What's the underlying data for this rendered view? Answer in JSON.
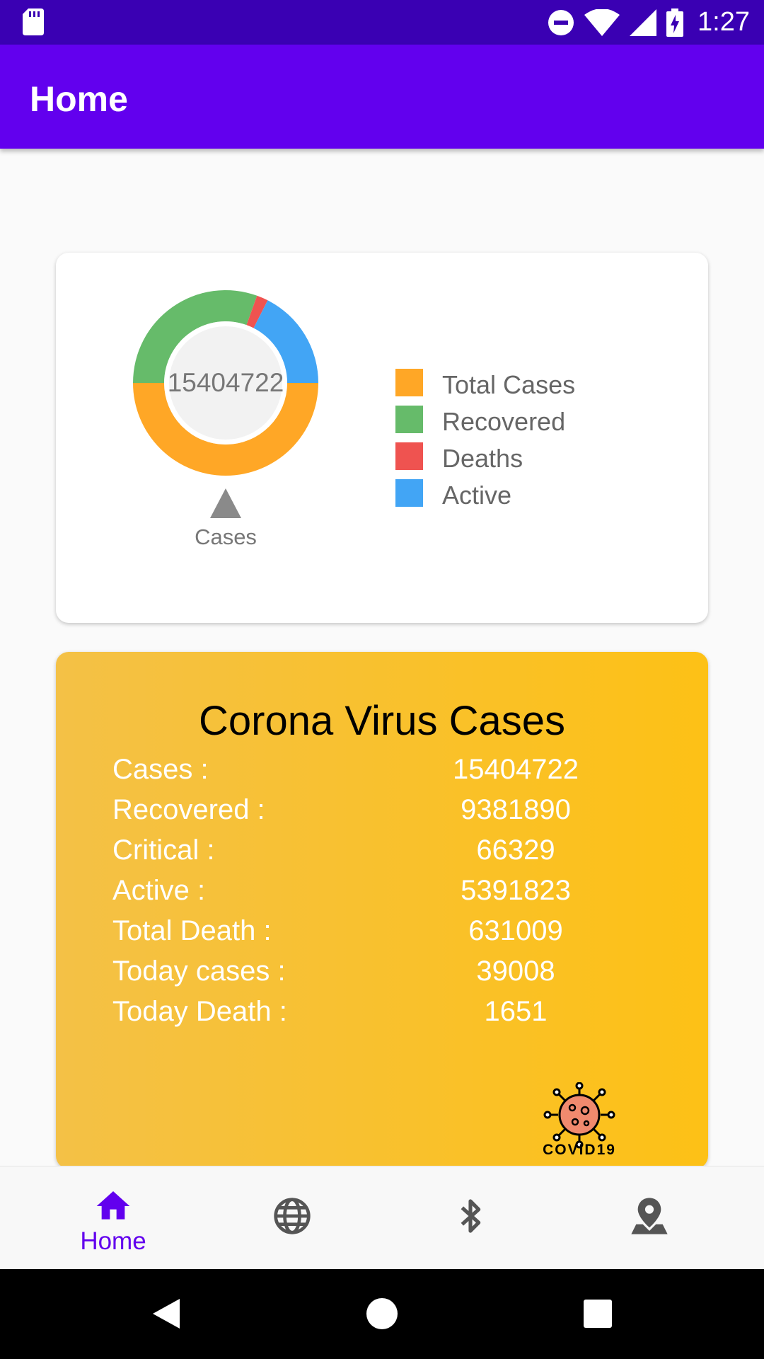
{
  "status_bar": {
    "time": "1:27",
    "icons": [
      "sd-card-icon",
      "do-not-disturb-icon",
      "wifi-icon",
      "signal-icon",
      "battery-charging-icon"
    ]
  },
  "app_bar": {
    "title": "Home"
  },
  "chart_data": {
    "type": "pie",
    "donut": true,
    "center_text": "15404722",
    "xlabel": "Cases",
    "legend": [
      {
        "name": "Total Cases",
        "color": "#ffa726"
      },
      {
        "name": "Recovered",
        "color": "#66bb6a"
      },
      {
        "name": "Deaths",
        "color": "#ef5350"
      },
      {
        "name": "Active",
        "color": "#42a5f5"
      }
    ],
    "slices": [
      {
        "name": "Total Cases",
        "value": 50,
        "color": "#ffa726"
      },
      {
        "name": "Recovered",
        "value": 30.5,
        "color": "#66bb6a"
      },
      {
        "name": "Deaths",
        "value": 2,
        "color": "#ef5350"
      },
      {
        "name": "Active",
        "value": 17.5,
        "color": "#42a5f5"
      }
    ]
  },
  "stats": {
    "title": "Corona Virus Cases",
    "rows": [
      {
        "label": "Cases :",
        "value": "15404722"
      },
      {
        "label": "Recovered :",
        "value": "9381890"
      },
      {
        "label": "Critical :",
        "value": "66329"
      },
      {
        "label": "Active :",
        "value": "5391823"
      },
      {
        "label": "Total Death :",
        "value": "631009"
      },
      {
        "label": "Today cases :",
        "value": "39008"
      },
      {
        "label": "Today Death :",
        "value": "1651"
      }
    ],
    "logo_text": "COVID19"
  },
  "bottom_nav": {
    "items": [
      {
        "label": "Home",
        "icon": "home-icon",
        "active": true
      },
      {
        "label": "",
        "icon": "globe-icon",
        "active": false
      },
      {
        "label": "",
        "icon": "bluetooth-icon",
        "active": false
      },
      {
        "label": "",
        "icon": "map-pin-icon",
        "active": false
      }
    ],
    "active_color": "#6200ee",
    "inactive_color": "#555555"
  },
  "colors": {
    "status_bar": "#3a00b3",
    "app_bar": "#6200ee",
    "stats_card": "#fdc116"
  }
}
